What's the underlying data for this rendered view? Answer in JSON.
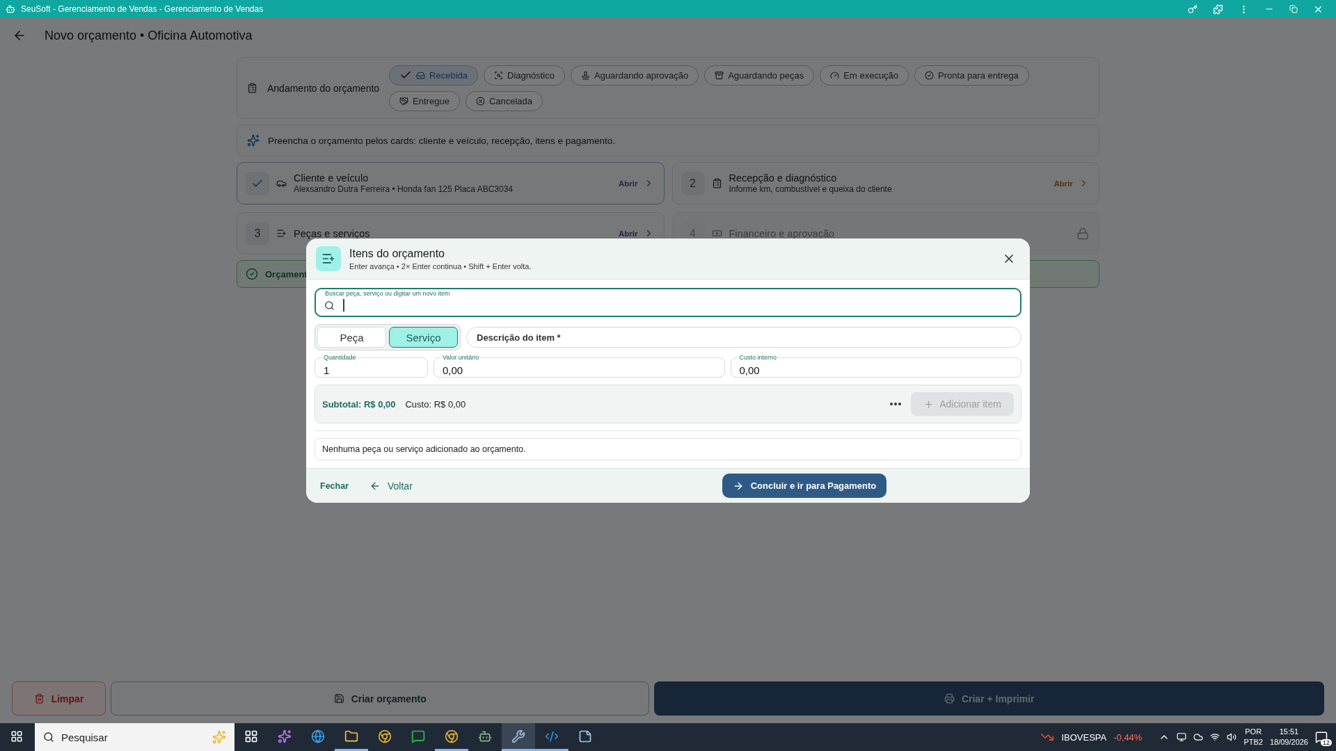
{
  "window": {
    "title": "SeuSoft - Gerenciamento de Vendas - Gerenciamento de Vendas"
  },
  "header": {
    "title": "Novo orçamento • Oficina Automotiva"
  },
  "progress": {
    "label": "Andamento do orçamento",
    "stages": [
      {
        "label": "Recebida",
        "kind": "inbox",
        "selected": true
      },
      {
        "label": "Diagnóstico",
        "kind": "search",
        "selected": false
      },
      {
        "label": "Aguardando aprovação",
        "kind": "stamp",
        "selected": false
      },
      {
        "label": "Aguardando peças",
        "kind": "archive",
        "selected": false
      },
      {
        "label": "Em execução",
        "kind": "gauge",
        "selected": false
      },
      {
        "label": "Pronta para entrega",
        "kind": "check",
        "selected": false
      },
      {
        "label": "Entregue",
        "kind": "handshake",
        "selected": false
      },
      {
        "label": "Cancelada",
        "kind": "cancel",
        "selected": false
      }
    ]
  },
  "hint": "Preencha o orçamento pelos cards: cliente e veículo, recepção, itens e pagamento.",
  "cards": [
    {
      "done": true,
      "title": "Cliente e veículo",
      "subtitle": "Alexsandro Dutra Ferreira • Honda fan 125 Placa ABC3034",
      "action": "Abrir",
      "disabled": false
    },
    {
      "step": "2",
      "done": false,
      "title": "Recepção e diagnóstico",
      "subtitle": "Informe km, combustível e queixa do cliente",
      "action": "Abrir",
      "disabled": false
    },
    {
      "step": "3",
      "done": false,
      "title": "Peças e serviços",
      "action": "Abrir",
      "disabled": false
    },
    {
      "step": "4",
      "done": false,
      "title": "Financeiro e aprovação",
      "disabled": true
    }
  ],
  "banner": {
    "text": "Orçament"
  },
  "modal": {
    "title": "Itens do orçamento",
    "subtitle": "Enter avança • 2× Enter continua • Shift + Enter volta.",
    "search": {
      "label": "Buscar peça, serviço ou digitar um novo item"
    },
    "types": [
      {
        "label": "Peça",
        "selected": false
      },
      {
        "label": "Serviço",
        "selected": true
      }
    ],
    "description": {
      "placeholder": "Descrição do item *"
    },
    "fields": [
      {
        "label": "Quantidade",
        "value": "1"
      },
      {
        "label": "Valor unitário",
        "value": "0,00"
      },
      {
        "label": "Custo interno",
        "value": "0,00"
      }
    ],
    "subtotal": "Subtotal: R$ 0,00",
    "cost": "Custo: R$ 0,00",
    "add_button": {
      "label": "Adicionar item",
      "disabled": true
    },
    "empty": "Nenhuma peça ou serviço adicionado ao orçamento.",
    "close": "Fechar",
    "back": "Voltar",
    "primary": "Concluir e ir para Pagamento"
  },
  "footer": {
    "clear": "Limpar",
    "create": "Criar orçamento",
    "create_print": "Criar + Imprimir"
  },
  "taskbar": {
    "search": "Pesquisar",
    "apps": [
      {
        "kind": "tasks",
        "running": false,
        "selected": false
      },
      {
        "kind": "copilot",
        "running": false,
        "selected": false
      },
      {
        "kind": "edge",
        "running": false,
        "selected": false
      },
      {
        "kind": "folder",
        "running": true,
        "selected": false
      },
      {
        "kind": "chrome",
        "running": false,
        "selected": false
      },
      {
        "kind": "chat",
        "running": false,
        "selected": false
      },
      {
        "kind": "chrome",
        "running": true,
        "selected": false
      },
      {
        "kind": "robot",
        "running": false,
        "selected": false
      },
      {
        "kind": "tool",
        "running": true,
        "selected": true
      },
      {
        "kind": "code",
        "running": true,
        "selected": false
      },
      {
        "kind": "note",
        "running": false,
        "selected": false
      }
    ],
    "ticker": "IBOVESPA",
    "change": "-0,44%",
    "lang": "POR",
    "layout": "PTB2",
    "time": "15:51",
    "date": "18/09/2026",
    "notifications": "12"
  }
}
